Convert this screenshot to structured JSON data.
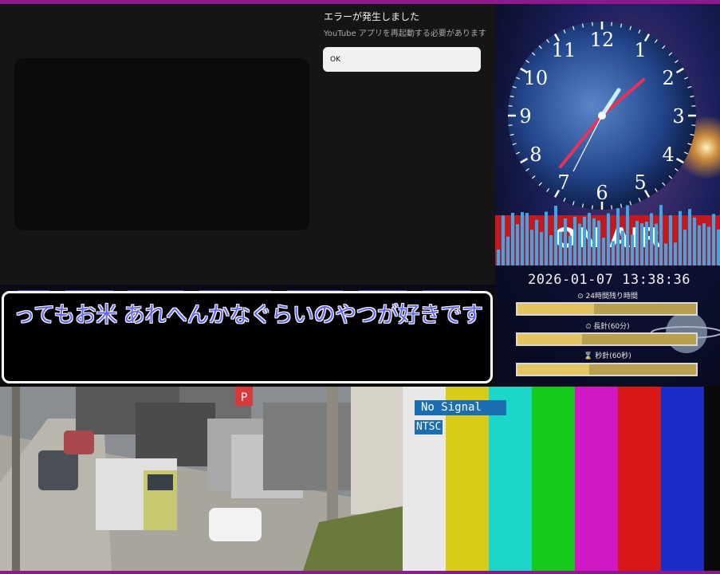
{
  "youtube_error": {
    "title": "エラーが発生しました",
    "message": "YouTube アプリを再起動する必要があります",
    "ok_label": "OK"
  },
  "clock": {
    "numerals": [
      "12",
      "1",
      "2",
      "3",
      "4",
      "5",
      "6",
      "7",
      "8",
      "9",
      "10",
      "11"
    ],
    "banner_text": "ON AIR",
    "datetime": "2026-01-07 13:38:36",
    "timers": [
      {
        "label": "⊙ 24時間残り時間",
        "progress": 0.43
      },
      {
        "label": "⏲ 長針(60分)",
        "progress": 0.36
      },
      {
        "label": "⌛ 秒針(60秒)",
        "progress": 0.4
      }
    ]
  },
  "subtitle": {
    "text": "ってもお米 あれへんかなぐらいのやつが好きです"
  },
  "street_cam": {
    "sign_text": "P"
  },
  "test_pattern": {
    "no_signal": "No Signal",
    "standard": "NTSC",
    "bar_colors": [
      "#e8e8e8",
      "#d8cc18",
      "#1cd6c8",
      "#14c81c",
      "#d018c4",
      "#d81818",
      "#1c2cc8"
    ]
  }
}
